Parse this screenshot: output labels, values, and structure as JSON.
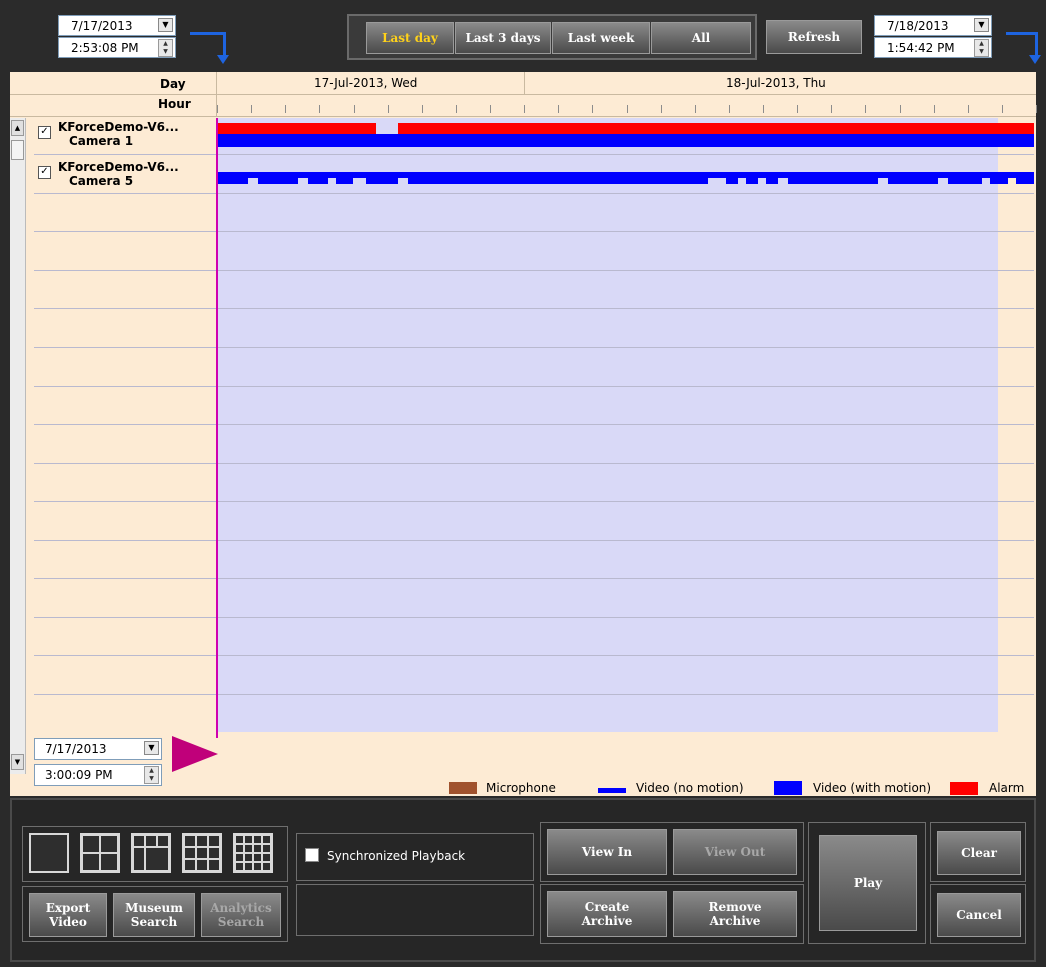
{
  "top": {
    "start_date": "7/17/2013",
    "start_time": "2:53:08 PM",
    "end_date": "7/18/2013",
    "end_time": "1:54:42 PM",
    "range_buttons": [
      {
        "label": "Last day",
        "active": true
      },
      {
        "label": "Last 3 days",
        "active": false
      },
      {
        "label": "Last week",
        "active": false
      },
      {
        "label": "All",
        "active": false
      }
    ],
    "refresh_label": "Refresh"
  },
  "timeline": {
    "day_header": "Day",
    "hour_header": "Hour",
    "day1": "17-Jul-2013, Wed",
    "day2": "18-Jul-2013, Thu",
    "cameras": [
      {
        "name": "KForceDemo-V6...",
        "camera": "Camera  1",
        "checked": true
      },
      {
        "name": "KForceDemo-V6...",
        "camera": "Camera  5",
        "checked": true
      }
    ]
  },
  "cursor": {
    "date": "7/17/2013",
    "time": "3:00:09 PM"
  },
  "legend": {
    "microphone": "Microphone",
    "video_no_motion": "Video (no motion)",
    "video_with_motion": "Video (with motion)",
    "alarm": "Alarm",
    "colors": {
      "microphone": "#a0522d",
      "video_no_motion": "#0000ff",
      "video_with_motion": "#0000ff",
      "alarm": "#ff0000"
    }
  },
  "bottom": {
    "sync_label": "Synchronized Playback",
    "export_video": [
      "Export",
      "Video"
    ],
    "museum_search": [
      "Museum",
      "Search"
    ],
    "analytics_search": [
      "Analytics",
      "Search"
    ],
    "view_in": "View In",
    "view_out": "View Out",
    "create_archive": [
      "Create",
      "Archive"
    ],
    "remove_archive": [
      "Remove",
      "Archive"
    ],
    "play": "Play",
    "clear": "Clear",
    "cancel": "Cancel"
  }
}
